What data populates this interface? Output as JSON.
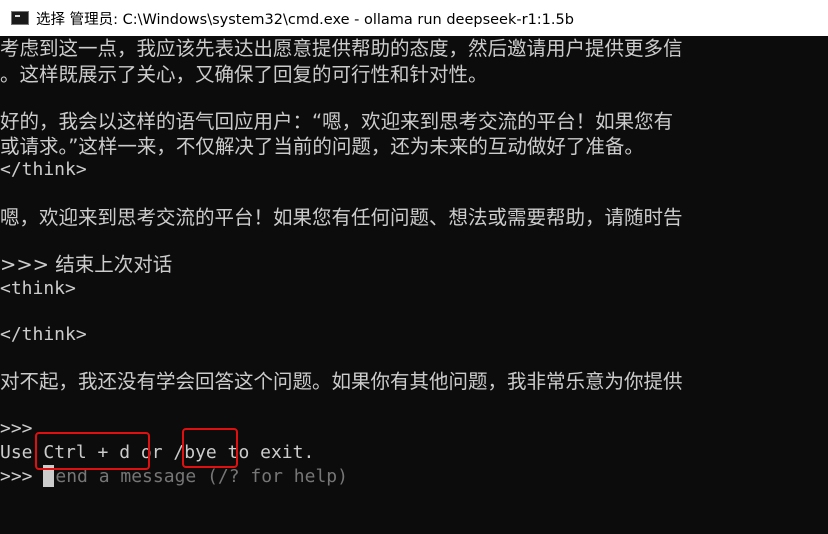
{
  "window": {
    "title": "选择 管理员: C:\\Windows\\system32\\cmd.exe - ollama  run deepseek-r1:1.5b"
  },
  "console": {
    "lines": [
      "考虑到这一点，我应该先表达出愿意提供帮助的态度，然后邀请用户提供更多信",
      "。这样既展示了关心，又确保了回复的可行性和针对性。",
      "好的，我会以这样的语气回应用户：“嗯，欢迎来到思考交流的平台！如果您有",
      "或请求。”这样一来，不仅解决了当前的问题，还为未来的互动做好了准备。",
      "</think>",
      "嗯，欢迎来到思考交流的平台！如果您有任何问题、想法或需要帮助，请随时告",
      ">>> 结束上次对话",
      "<think>",
      "</think>",
      "对不起，我还没有学会回答这个问题。如果你有其他问题，我非常乐意为你提供",
      ">>>"
    ],
    "exit_hint": {
      "prefix": "Use ",
      "shortcut": "Ctrl + d",
      "middle": " or ",
      "command": "/bye",
      "suffix": " to exit."
    },
    "prompt": {
      "symbol": ">>> ",
      "cursor_char": "S",
      "placeholder_rest": "end a message (/? for help)"
    }
  },
  "colors": {
    "background": "#0c0c0c",
    "text": "#cccccc",
    "placeholder": "#767676",
    "highlight": "#e01010"
  },
  "icons": {
    "app": "cmd-window-icon"
  }
}
